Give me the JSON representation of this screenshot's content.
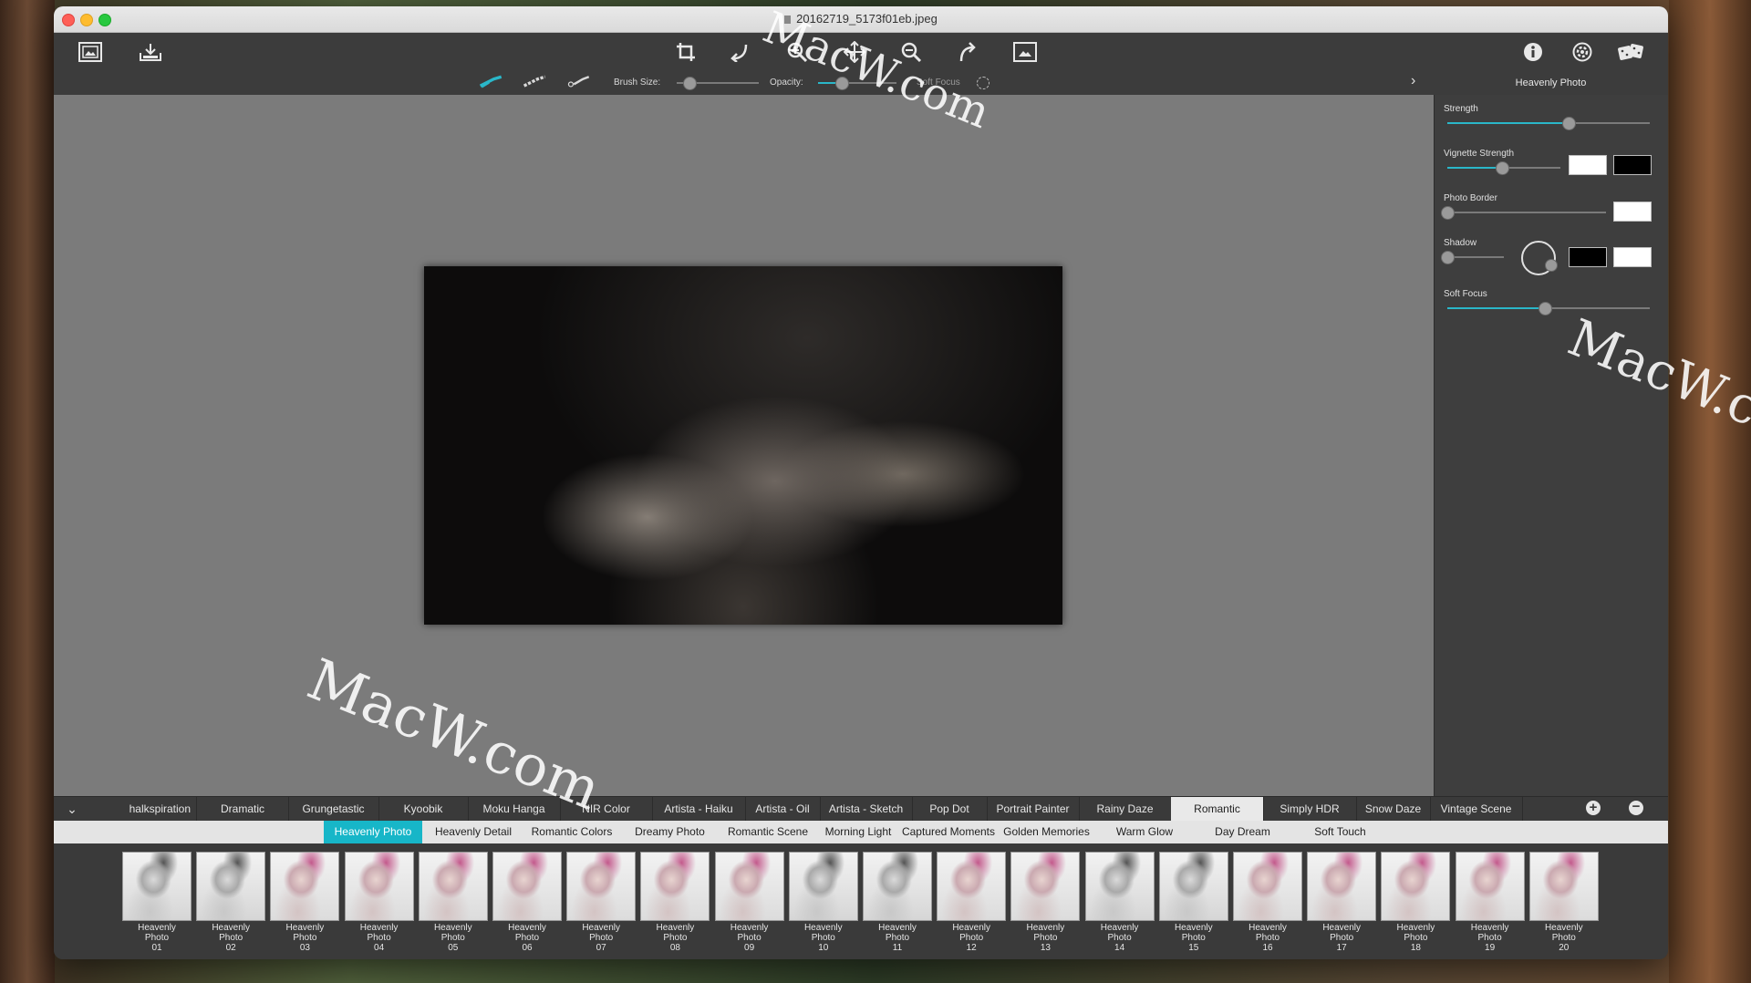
{
  "window": {
    "title": "20162719_5173f01eb.jpeg"
  },
  "toolbar": {
    "left_icons": [
      "image-icon",
      "save-icon"
    ],
    "center_icons": [
      "crop-icon",
      "rotate-icon",
      "zoom-in-icon",
      "move-icon",
      "zoom-out-icon",
      "redo-icon",
      "fit-screen-icon"
    ],
    "right_icons": [
      "info-icon",
      "settings-icon",
      "random-icon"
    ]
  },
  "subbar": {
    "brush_size_label": "Brush Size:",
    "brush_size_value": 0.15,
    "opacity_label": "Opacity:",
    "opacity_value": 0.3,
    "soft_focus_label": "Soft Focus"
  },
  "panel": {
    "title": "Heavenly Photo",
    "controls": {
      "strength": {
        "label": "Strength",
        "value": 0.6
      },
      "vignette": {
        "label": "Vignette Strength",
        "value": 0.48,
        "color1": "#ffffff",
        "color2": "#000000"
      },
      "border": {
        "label": "Photo Border",
        "value": 0.0,
        "color": "#ffffff"
      },
      "shadow": {
        "label": "Shadow",
        "value": 0.0,
        "color1": "#000000",
        "color2": "#ffffff"
      },
      "soft_focus": {
        "label": "Soft Focus",
        "value": 0.48
      }
    }
  },
  "watermark": {
    "text": "MacW.com"
  },
  "categories": [
    "halkspiration",
    "Dramatic",
    "Grungetastic",
    "Kyoobik",
    "Moku Hanga",
    "NIR Color",
    "Artista - Haiku",
    "Artista - Oil",
    "Artista - Sketch",
    "Pop Dot",
    "Portrait Painter",
    "Rainy Daze",
    "Romantic",
    "Simply HDR",
    "Snow Daze",
    "Vintage Scene"
  ],
  "active_category": "Romantic",
  "presets": [
    "Heavenly Photo",
    "Heavenly Detail",
    "Romantic Colors",
    "Dreamy Photo",
    "Romantic Scene",
    "Morning Light",
    "Captured Moments",
    "Golden Memories",
    "Warm Glow",
    "Day Dream",
    "Soft Touch"
  ],
  "active_preset": "Heavenly Photo",
  "thumbnails": [
    {
      "line1": "Heavenly",
      "line2": "Photo",
      "num": "01",
      "gray": true
    },
    {
      "line1": "Heavenly",
      "line2": "Photo",
      "num": "02",
      "gray": true
    },
    {
      "line1": "Heavenly",
      "line2": "Photo",
      "num": "03",
      "gray": false
    },
    {
      "line1": "Heavenly",
      "line2": "Photo",
      "num": "04",
      "gray": false
    },
    {
      "line1": "Heavenly",
      "line2": "Photo",
      "num": "05",
      "gray": false
    },
    {
      "line1": "Heavenly",
      "line2": "Photo",
      "num": "06",
      "gray": false
    },
    {
      "line1": "Heavenly",
      "line2": "Photo",
      "num": "07",
      "gray": false
    },
    {
      "line1": "Heavenly",
      "line2": "Photo",
      "num": "08",
      "gray": false
    },
    {
      "line1": "Heavenly",
      "line2": "Photo",
      "num": "09",
      "gray": false
    },
    {
      "line1": "Heavenly",
      "line2": "Photo",
      "num": "10",
      "gray": true
    },
    {
      "line1": "Heavenly",
      "line2": "Photo",
      "num": "11",
      "gray": true
    },
    {
      "line1": "Heavenly",
      "line2": "Photo",
      "num": "12",
      "gray": false
    },
    {
      "line1": "Heavenly",
      "line2": "Photo",
      "num": "13",
      "gray": false
    },
    {
      "line1": "Heavenly",
      "line2": "Photo",
      "num": "14",
      "gray": true
    },
    {
      "line1": "Heavenly",
      "line2": "Photo",
      "num": "15",
      "gray": true
    },
    {
      "line1": "Heavenly",
      "line2": "Photo",
      "num": "16",
      "gray": false
    },
    {
      "line1": "Heavenly",
      "line2": "Photo",
      "num": "17",
      "gray": false
    },
    {
      "line1": "Heavenly",
      "line2": "Photo",
      "num": "18",
      "gray": false
    },
    {
      "line1": "Heavenly",
      "line2": "Photo",
      "num": "19",
      "gray": false
    },
    {
      "line1": "Heavenly",
      "line2": "Photo",
      "num": "20",
      "gray": false
    }
  ],
  "colors": {
    "accent": "#17b6c8",
    "canvas": "#7b7b7b",
    "panel": "#3e3e3e"
  }
}
